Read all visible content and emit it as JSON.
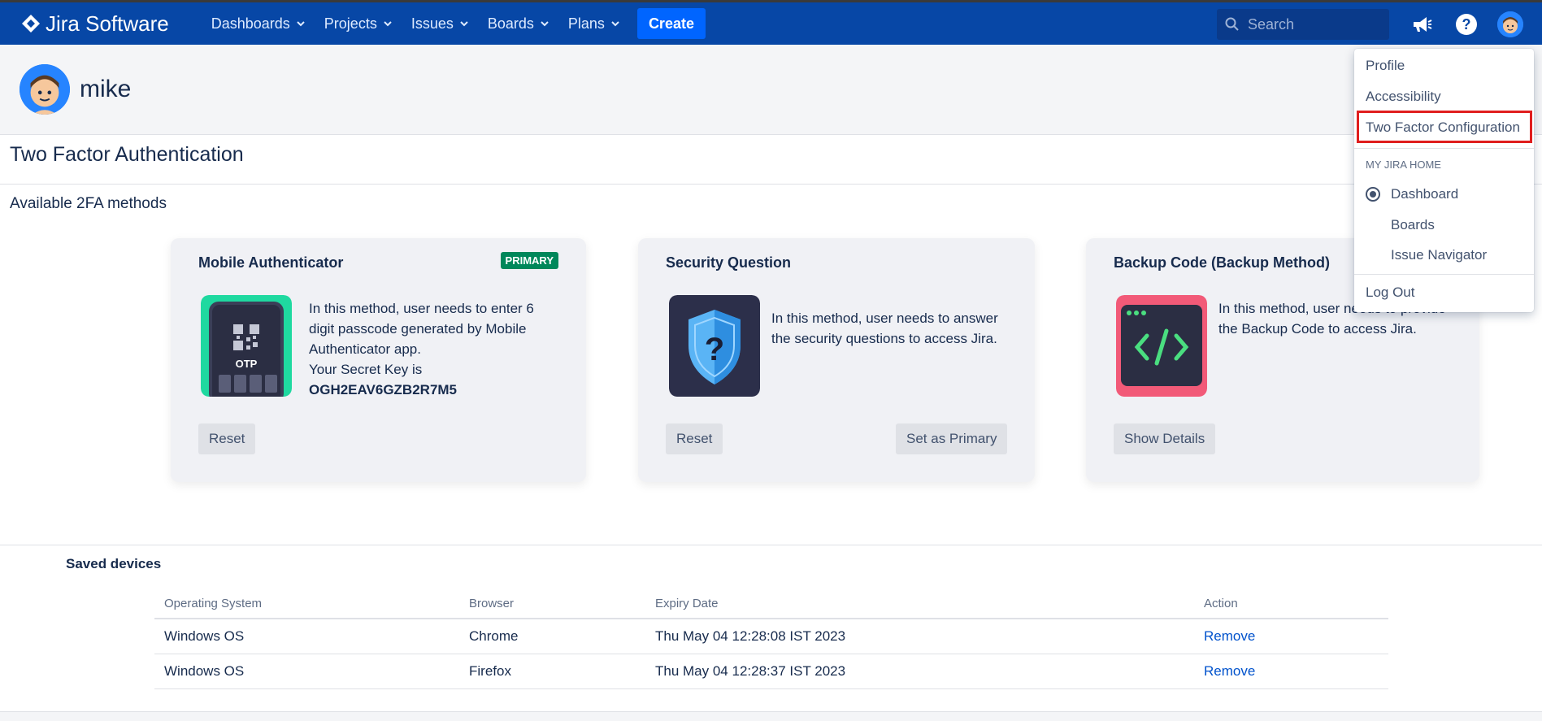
{
  "app": {
    "logo_text": "Jira Software",
    "brand_color": "#0747a6"
  },
  "nav": {
    "items": [
      {
        "label": "Dashboards"
      },
      {
        "label": "Projects"
      },
      {
        "label": "Issues"
      },
      {
        "label": "Boards"
      },
      {
        "label": "Plans"
      }
    ],
    "create_label": "Create",
    "search_placeholder": "Search",
    "icons": [
      "megaphone-icon",
      "help-icon",
      "user-avatar"
    ]
  },
  "profile": {
    "username": "mike"
  },
  "page": {
    "title": "Two Factor Authentication",
    "methods_title": "Available 2FA methods"
  },
  "methods": [
    {
      "title": "Mobile Authenticator",
      "badge": "PRIMARY",
      "description": "In this method, user needs to enter 6 digit passcode generated by Mobile Authenticator app.",
      "secret_label": "Your Secret Key is",
      "secret_key": "OGH2EAV6GZB2R7M5",
      "icon_label": "OTP",
      "buttons": [
        "Reset"
      ]
    },
    {
      "title": "Security Question",
      "description": "In this method, user needs to answer the security questions to access Jira.",
      "buttons": [
        "Reset",
        "Set as Primary"
      ]
    },
    {
      "title": "Backup Code (Backup Method)",
      "description": "In this method, user needs to provide the Backup Code to access Jira.",
      "buttons": [
        "Show Details"
      ]
    }
  ],
  "saved_devices": {
    "title": "Saved devices",
    "columns": [
      "Operating System",
      "Browser",
      "Expiry Date",
      "Action"
    ],
    "rows": [
      {
        "os": "Windows OS",
        "browser": "Chrome",
        "expiry": "Thu May 04 12:28:08 IST 2023",
        "action": "Remove"
      },
      {
        "os": "Windows OS",
        "browser": "Firefox",
        "expiry": "Thu May 04 12:28:37 IST 2023",
        "action": "Remove"
      }
    ]
  },
  "user_menu": {
    "items": [
      "Profile",
      "Accessibility",
      "Two Factor Configuration"
    ],
    "highlighted": "Two Factor Configuration",
    "home_heading": "MY JIRA HOME",
    "home_options": [
      "Dashboard",
      "Boards",
      "Issue Navigator"
    ],
    "home_selected": "Dashboard",
    "logout": "Log Out"
  }
}
